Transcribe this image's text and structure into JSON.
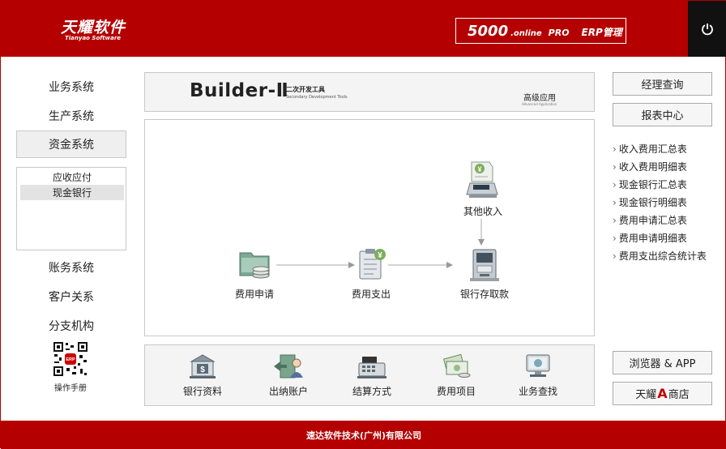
{
  "header": {
    "logo_text": "天耀软件",
    "logo_sub": "Tianyao Software",
    "edition_num": "5000",
    "edition_online": ".online",
    "edition_pro": "PRO",
    "edition_erp": "ERP管理",
    "power_icon": "power-icon"
  },
  "nav": {
    "items": [
      "业务系统",
      "生产系统",
      "资金系统",
      "账务系统",
      "客户关系",
      "分支机构"
    ],
    "active": "资金系统",
    "sub_items": [
      "应收应付",
      "现金银行"
    ],
    "sub_selected": "现金银行",
    "qr_label": "操作手册"
  },
  "banner": {
    "title": "Builder-Ⅱ",
    "subtitle_cn": "二次开发工具",
    "subtitle_en": "Secondary Development Tools",
    "advanced": "高级应用",
    "advanced_en": "Advanced Application"
  },
  "flow": {
    "nodes": {
      "other_income": "其他收入",
      "expense_apply": "费用申请",
      "expense_pay": "费用支出",
      "bank": "银行存取款"
    }
  },
  "quick": {
    "items": [
      "银行资料",
      "出纳账户",
      "结算方式",
      "费用项目",
      "业务查找"
    ]
  },
  "right": {
    "buttons": [
      "经理查询",
      "报表中心"
    ],
    "links": [
      "收入费用汇总表",
      "收入费用明细表",
      "现金银行汇总表",
      "现金银行明细表",
      "费用申请汇总表",
      "费用申请明细表",
      "费用支出综合统计表"
    ],
    "browser_btn": "浏览器 & APP",
    "store_left": "天耀",
    "store_a": "A",
    "store_right": "商店"
  },
  "footer": {
    "company": "速达软件技术(广州)有限公司"
  },
  "colors": {
    "brand_red": "#b40000",
    "panel_bg": "#f4f4f4",
    "border": "#c8c8c8"
  }
}
